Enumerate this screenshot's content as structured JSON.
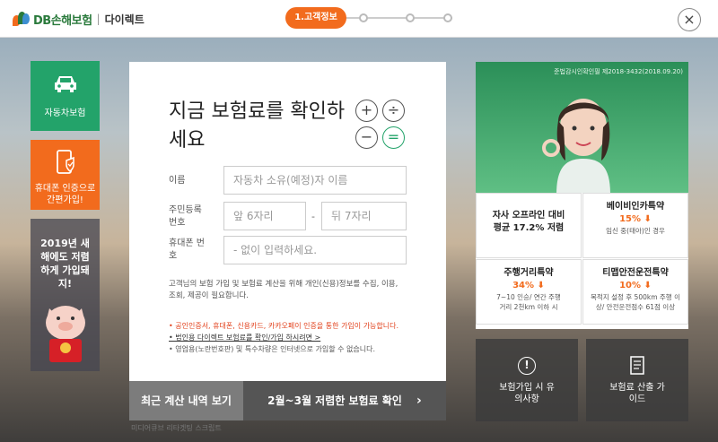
{
  "header": {
    "brand": "DB손해보험",
    "brand_sub": "다이렉트",
    "step_active": "1.고객정보",
    "close_label": "×"
  },
  "sidebar": {
    "car_label": "자동차보험",
    "phone_label": "휴대폰 인증으로 간편가입!",
    "promo_text": "2019년 새해에도 저렴하게 가입돼지!"
  },
  "form": {
    "title": "지금 보험료를 확인하세요",
    "name_label": "이름",
    "name_placeholder": "자동차 소유(예정)자 이름",
    "rrn_label": "주민등록 번호",
    "rrn_front_placeholder": "앞 6자리",
    "rrn_dash": "-",
    "rrn_back_placeholder": "뒤 7자리",
    "phone_label": "휴대폰 번호",
    "phone_placeholder": "- 없이 입력하세요.",
    "notice": "고객님의 보험 가입 및 보험료 계산을 위해 개인(신용)정보를 수집, 이용, 조회, 제공이 필요합니다.",
    "bullets": [
      "• 공인인증서, 휴대폰, 신용카드, 카카오페이 인증을 통한 가입이 가능합니다.",
      "• 법인용 다이렉트 보험료를 확인/가입 하시려면 >",
      "• 영업용(노란번호판) 및 특수차량은 인터넷으로 가입할 수 없습니다."
    ],
    "recent_button": "최근 계산 내역 보기",
    "cheap_button": "2월~3월 저렴한 보험료 확인",
    "image_alt": "미디어큐브 리타겟팅 스크립트"
  },
  "promo": {
    "registration": "준법감시인확인필 제2018-3432(2018.09.20)",
    "cells": [
      {
        "title": "자사 오프라인 대비",
        "num": "평균 17.2% 저렴",
        "desc": ""
      },
      {
        "title": "베이비인카특약",
        "num": "15% ⬇",
        "desc": "임신 중(태아)인 경우"
      },
      {
        "title": "주행거리특약",
        "num": "34% ⬇",
        "desc": "7~10 인승/ 연간 주행거리 2천km 이하 시"
      },
      {
        "title": "티맵안전운전특약",
        "num": "10% ⬇",
        "desc": "목적지 설정 후 500km 주행 이상/ 안전운전점수 61점 이상"
      }
    ],
    "box1": "보험가입 시 유의사항",
    "box2": "보험료 산출 가이드"
  },
  "colors": {
    "green": "#23a36a",
    "orange": "#f26b1d"
  }
}
